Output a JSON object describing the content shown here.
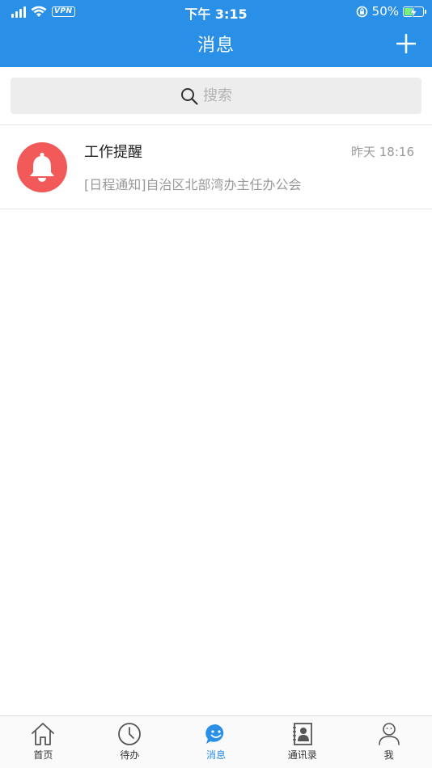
{
  "status_bar": {
    "time": "下午 3:15",
    "vpn": "VPN",
    "battery": "50%"
  },
  "header": {
    "title": "消息"
  },
  "search": {
    "placeholder": "搜索"
  },
  "messages": [
    {
      "title": "工作提醒",
      "time": "昨天 18:16",
      "preview": "[日程通知]自治区北部湾办主任办公会",
      "icon": "bell-icon"
    }
  ],
  "tabs": [
    {
      "label": "首页",
      "icon": "home-icon"
    },
    {
      "label": "待办",
      "icon": "clock-icon"
    },
    {
      "label": "消息",
      "icon": "chat-smile-icon",
      "active": true
    },
    {
      "label": "通讯录",
      "icon": "contacts-book-icon"
    },
    {
      "label": "我",
      "icon": "user-icon"
    }
  ],
  "colors": {
    "primary": "#2a8fe6",
    "avatar_red": "#f25a5a",
    "battery_green": "#7cf07c"
  }
}
